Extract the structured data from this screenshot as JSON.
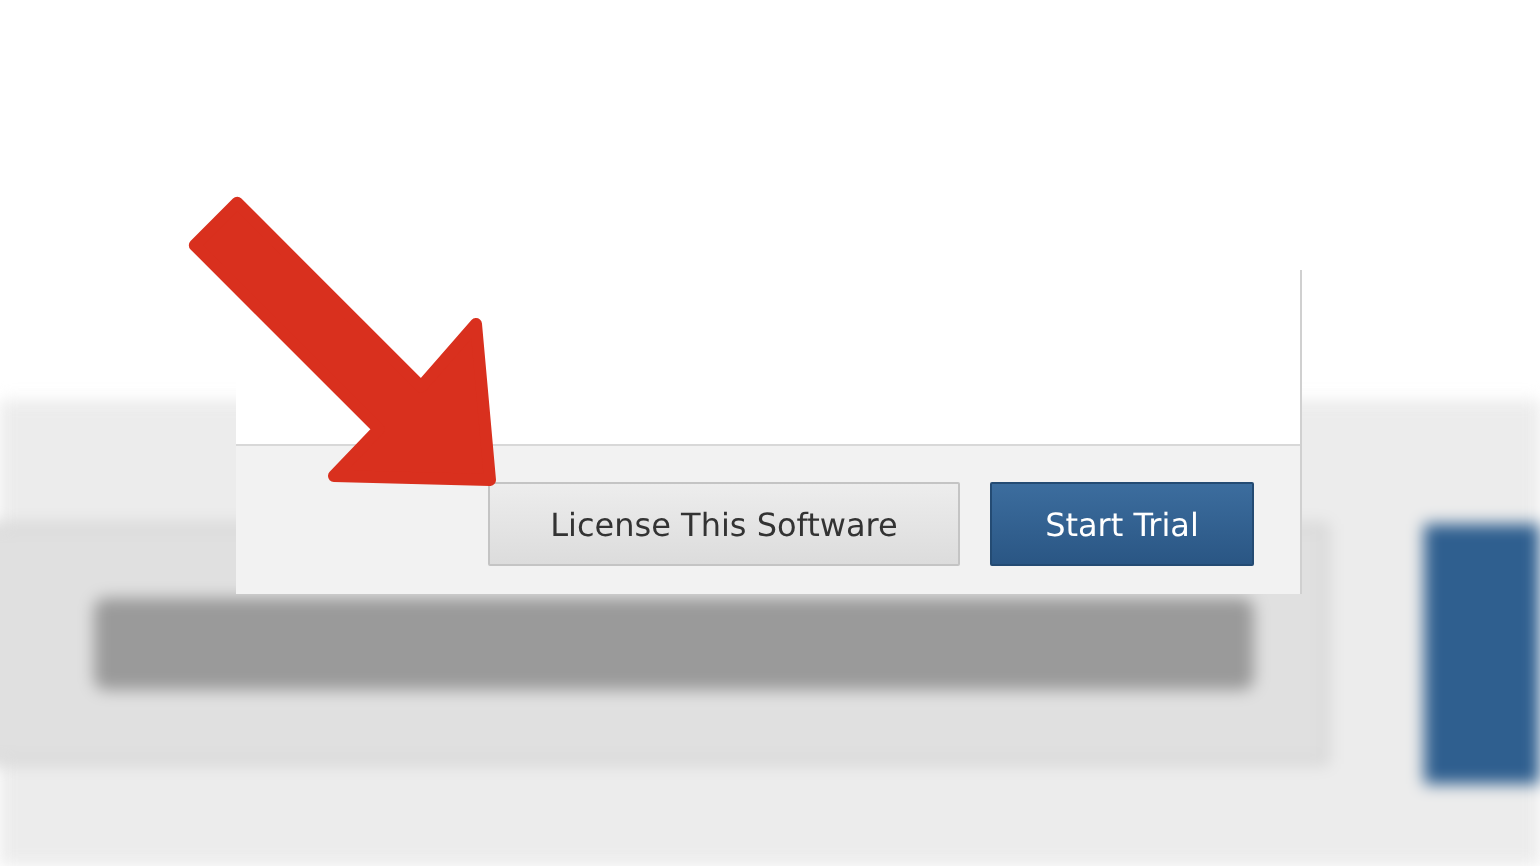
{
  "dialog": {
    "buttons": [
      {
        "label": "License This Software",
        "kind": "secondary"
      },
      {
        "label": "Start Trial",
        "kind": "primary"
      }
    ]
  }
}
